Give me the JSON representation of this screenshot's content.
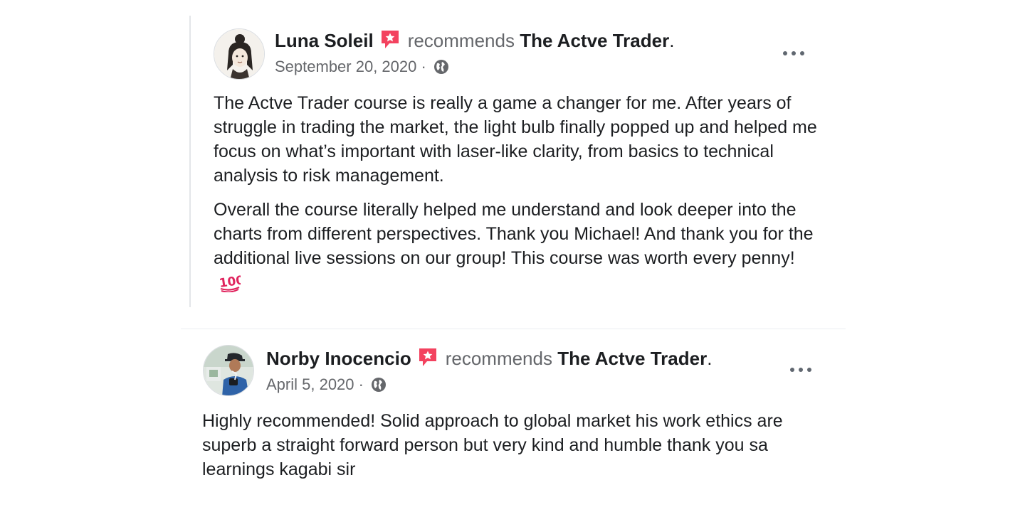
{
  "posts": [
    {
      "author": "Luna Soleil",
      "verb": "recommends",
      "page": "The Actve Trader",
      "period": ".",
      "date": "September 20, 2020",
      "separator": "·",
      "paragraphs": [
        "The Actve Trader course is really a game a changer for me. After years of struggle in trading the market, the light bulb finally popped up and helped me focus on what’s important with laser-like clarity, from basics to technical analysis to risk management.",
        "Overall the course literally helped me understand and look deeper into the charts from different perspectives. Thank you Michael! And thank you for the additional live sessions on our group! This course was worth every penny!"
      ],
      "icons": {
        "badge": "recommendation-badge-icon",
        "privacy": "globe-icon",
        "menu": "more-options-icon",
        "emoji": "hundred-points-emoji-icon"
      }
    },
    {
      "author": "Norby Inocencio",
      "verb": "recommends",
      "page": "The Actve Trader",
      "period": ".",
      "date": "April 5, 2020",
      "separator": "·",
      "paragraphs": [
        "Highly recommended! Solid approach to global market his work ethics are superb a straight forward person but very kind and humble thank you sa learnings kagabi sir"
      ],
      "icons": {
        "badge": "recommendation-badge-icon",
        "privacy": "globe-icon",
        "menu": "more-options-icon"
      }
    }
  ],
  "colors": {
    "badge": "#f3425f",
    "secondary_text": "#65676b",
    "primary_text": "#1c1e21",
    "emoji_red": "#e0245e"
  }
}
